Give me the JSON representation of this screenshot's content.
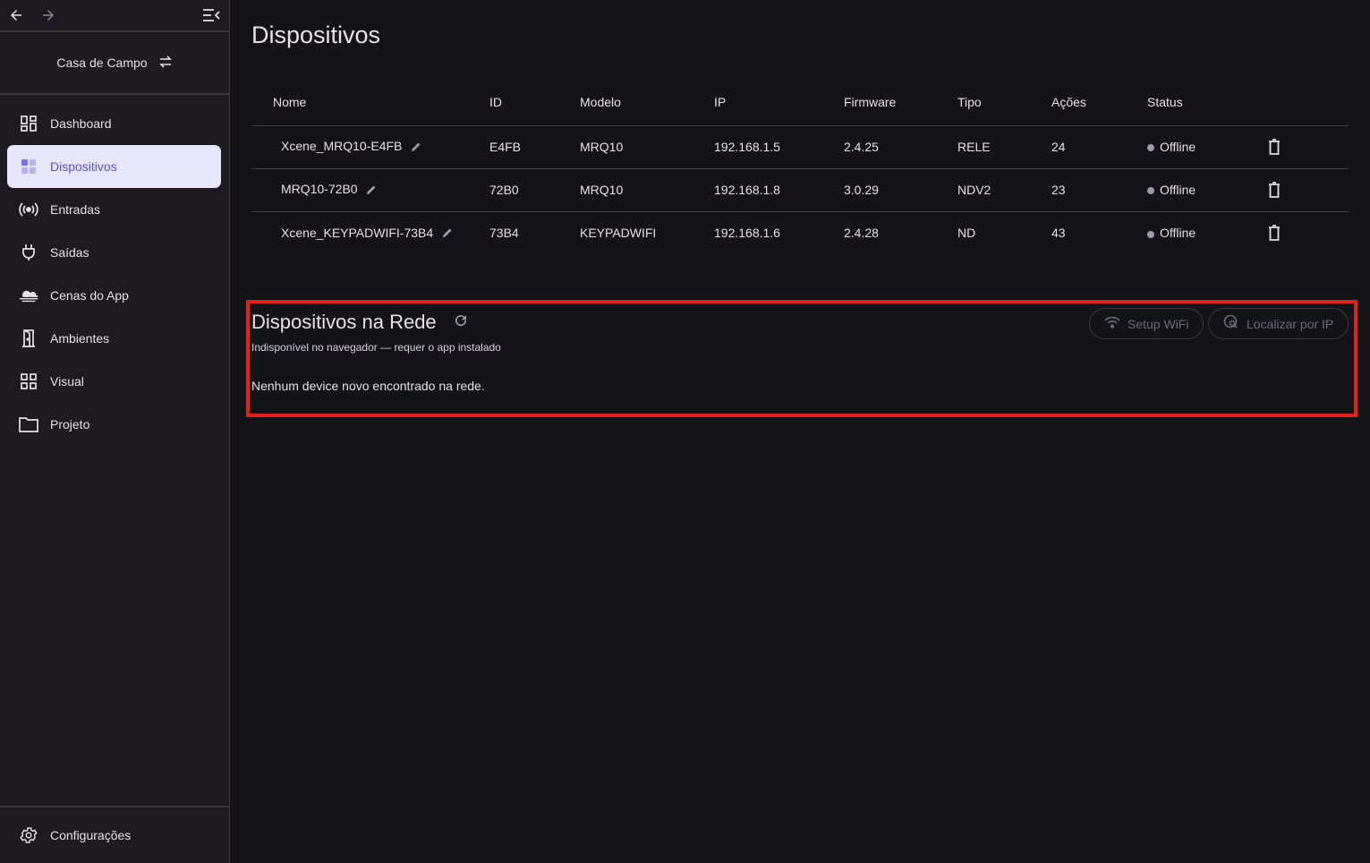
{
  "sidebar": {
    "project_name": "Casa de Campo",
    "items": [
      {
        "label": "Dashboard",
        "icon": "dashboard-icon"
      },
      {
        "label": "Dispositivos",
        "icon": "devices-icon",
        "active": true
      },
      {
        "label": "Entradas",
        "icon": "sensors-icon"
      },
      {
        "label": "Saídas",
        "icon": "plug-icon"
      },
      {
        "label": "Cenas do App",
        "icon": "cloud-icon"
      },
      {
        "label": "Ambientes",
        "icon": "door-icon"
      },
      {
        "label": "Visual",
        "icon": "grid-icon"
      },
      {
        "label": "Projeto",
        "icon": "folder-icon"
      }
    ],
    "settings_label": "Configurações"
  },
  "main": {
    "title": "Dispositivos",
    "table": {
      "headers": [
        "Nome",
        "ID",
        "Modelo",
        "IP",
        "Firmware",
        "Tipo",
        "Ações",
        "Status"
      ],
      "rows": [
        {
          "name": "Xcene_MRQ10-E4FB",
          "id": "E4FB",
          "model": "MRQ10",
          "ip": "192.168.1.5",
          "firmware": "2.4.25",
          "type": "RELE",
          "actions": "24",
          "status": "Offline"
        },
        {
          "name": "MRQ10-72B0",
          "id": "72B0",
          "model": "MRQ10",
          "ip": "192.168.1.8",
          "firmware": "3.0.29",
          "type": "NDV2",
          "actions": "23",
          "status": "Offline"
        },
        {
          "name": "Xcene_KEYPADWIFI-73B4",
          "id": "73B4",
          "model": "KEYPADWIFI",
          "ip": "192.168.1.6",
          "firmware": "2.4.28",
          "type": "ND",
          "actions": "43",
          "status": "Offline"
        }
      ]
    },
    "network": {
      "title": "Dispositivos na Rede",
      "subtitle": "Indisponível no navegador — requer o app instalado",
      "empty_text": "Nenhum device novo encontrado na rede.",
      "setup_wifi_label": "Setup WiFi",
      "locate_ip_label": "Localizar por IP"
    }
  },
  "colors": {
    "accent": "#5b52c9",
    "active_bg": "#e8e6fb",
    "highlight": "#e0221b",
    "background": "#141318",
    "sidebar_bg": "#1d1b20"
  }
}
